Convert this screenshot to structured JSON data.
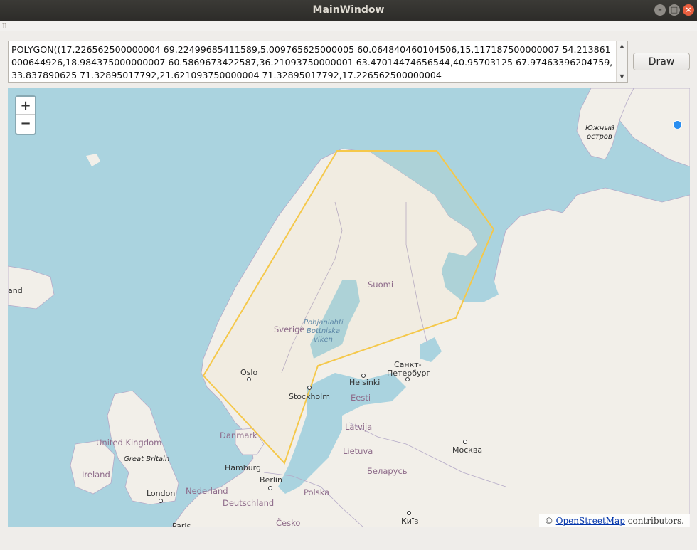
{
  "window": {
    "title": "MainWindow"
  },
  "editor": {
    "text": "POLYGON((17.226562500000004 69.22499685411589,5.009765625000005 60.064840460104506,15.117187500000007 54.213861000644926,18.984375000000007 60.5869673422587,36.21093750000001 63.47014474656544,40.95703125 67.97463396204759,33.837890625 71.32895017792,21.621093750000004 71.32895017792,17.226562500000004"
  },
  "toolbar": {
    "draw_label": "Draw"
  },
  "map": {
    "zoom_in": "+",
    "zoom_out": "−",
    "attribution": {
      "prefix": "© ",
      "link": "OpenStreetMap",
      "suffix": " contributors."
    },
    "labels": {
      "iceland_partial": "and",
      "yuzhny1": "Южный",
      "yuzhny2": "остров",
      "suomi": "Suomi",
      "sverige": "Sverige",
      "bothnia1": "Pohjanlahti",
      "bothnia2": "Bottniska",
      "bothnia3": "viken",
      "oslo": "Oslo",
      "stockholm": "Stockholm",
      "helsinki": "Helsinki",
      "spb1": "Санкт-",
      "spb2": "Петербург",
      "eesti": "Eesti",
      "danmark": "Danmark",
      "latvija": "Latvija",
      "lietuva": "Lietuva",
      "moskva": "Москва",
      "uk": "United Kingdom",
      "gb": "Great Britain",
      "ireland": "Ireland",
      "hamburg": "Hamburg",
      "belarus": "Беларусь",
      "berlin": "Berlin",
      "nederland": "Nederland",
      "london": "London",
      "deutschland": "Deutschland",
      "polska": "Polska",
      "paris": "Paris",
      "cesko": "Česko",
      "kyiv": "Київ"
    },
    "colors": {
      "water": "#aad3df",
      "land": "#f2efe9",
      "polygon": "#f5c84a",
      "location": "#2a8ef0"
    }
  }
}
